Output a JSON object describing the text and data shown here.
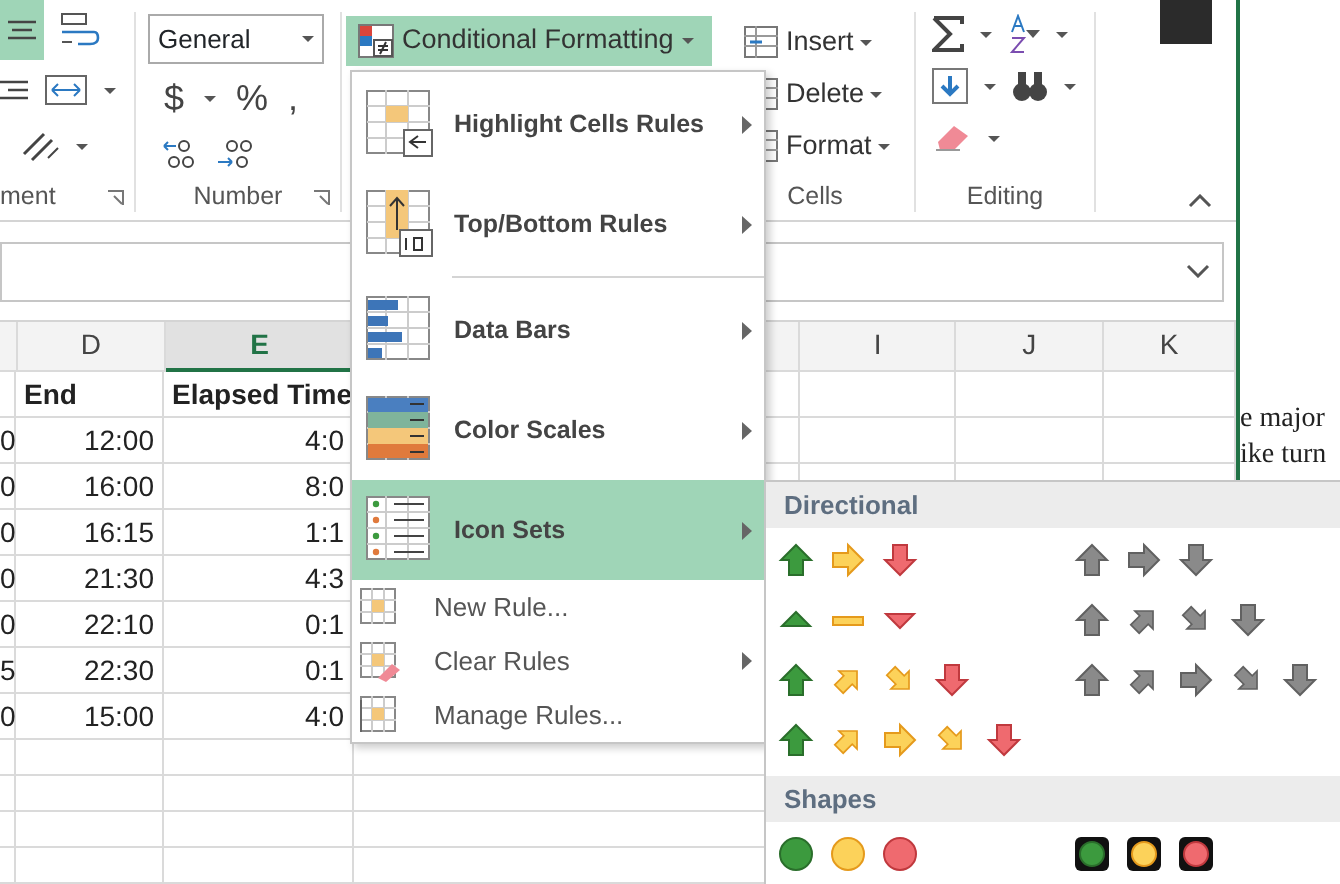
{
  "ribbon": {
    "groups": [
      {
        "kind": "alignment",
        "label": "ment"
      },
      {
        "kind": "number",
        "label": "Number",
        "format": "General",
        "symbols": [
          "$",
          "%",
          ","
        ]
      },
      {
        "kind": "styles",
        "button": {
          "label": "Conditional Formatting",
          "selected": true
        }
      },
      {
        "kind": "cells",
        "label": "Cells",
        "buttons": [
          "Insert",
          "Delete",
          "Format"
        ]
      },
      {
        "kind": "editing",
        "label": "Editing"
      }
    ]
  },
  "sheet": {
    "columns": [
      {
        "label": "D",
        "selected": false
      },
      {
        "label": "E",
        "selected": true
      },
      {
        "label": "I",
        "selected": false
      },
      {
        "label": "J",
        "selected": false
      },
      {
        "label": "K",
        "selected": false
      }
    ],
    "header_row": [
      "End",
      "Elapsed Time"
    ],
    "stub_column": [
      "0",
      "0",
      "0",
      "0",
      "0",
      "5",
      "0"
    ],
    "rows": [
      [
        "12:00",
        "4:0"
      ],
      [
        "16:00",
        "8:0"
      ],
      [
        "16:15",
        "1:1"
      ],
      [
        "21:30",
        "4:3"
      ],
      [
        "22:10",
        "0:1"
      ],
      [
        "22:30",
        "0:1"
      ],
      [
        "15:00",
        "4:0"
      ]
    ]
  },
  "background_document": {
    "lines": [
      "e major",
      "ike turn"
    ]
  },
  "menu": {
    "items": [
      {
        "label": "Highlight Cells Rules",
        "kind": "highlight",
        "submenu": true,
        "separator_before": false,
        "selected": false
      },
      {
        "label": "Top/Bottom Rules",
        "kind": "topbottom",
        "submenu": true,
        "separator_before": false,
        "selected": false
      },
      {
        "label": "Data Bars",
        "kind": "databars",
        "submenu": true,
        "separator_before": true,
        "selected": false
      },
      {
        "label": "Color Scales",
        "kind": "colorscales",
        "submenu": true,
        "separator_before": false,
        "selected": false
      },
      {
        "label": "Icon Sets",
        "kind": "iconsets",
        "submenu": true,
        "separator_before": false,
        "selected": true
      },
      {
        "label": "New Rule...",
        "kind": "newrule",
        "submenu": false,
        "separator_before": false,
        "selected": false
      },
      {
        "label": "Clear Rules",
        "kind": "clearrules",
        "submenu": true,
        "separator_before": false,
        "selected": false
      },
      {
        "label": "Manage Rules...",
        "kind": "managerules",
        "submenu": false,
        "separator_before": false,
        "selected": false
      }
    ]
  },
  "submenu": {
    "sections": [
      {
        "title": "Directional",
        "sets": [
          {
            "kind": "arrows3_color"
          },
          {
            "kind": "arrows3_gray"
          },
          {
            "kind": "triangles3"
          },
          {
            "kind": "arrows4_gray"
          },
          {
            "kind": "arrows4_color"
          },
          {
            "kind": "arrows5_gray"
          },
          {
            "kind": "arrows5_color"
          }
        ]
      },
      {
        "title": "Shapes",
        "sets": [
          {
            "kind": "lights3_plain"
          },
          {
            "kind": "lights3_rimmed"
          }
        ]
      }
    ]
  }
}
